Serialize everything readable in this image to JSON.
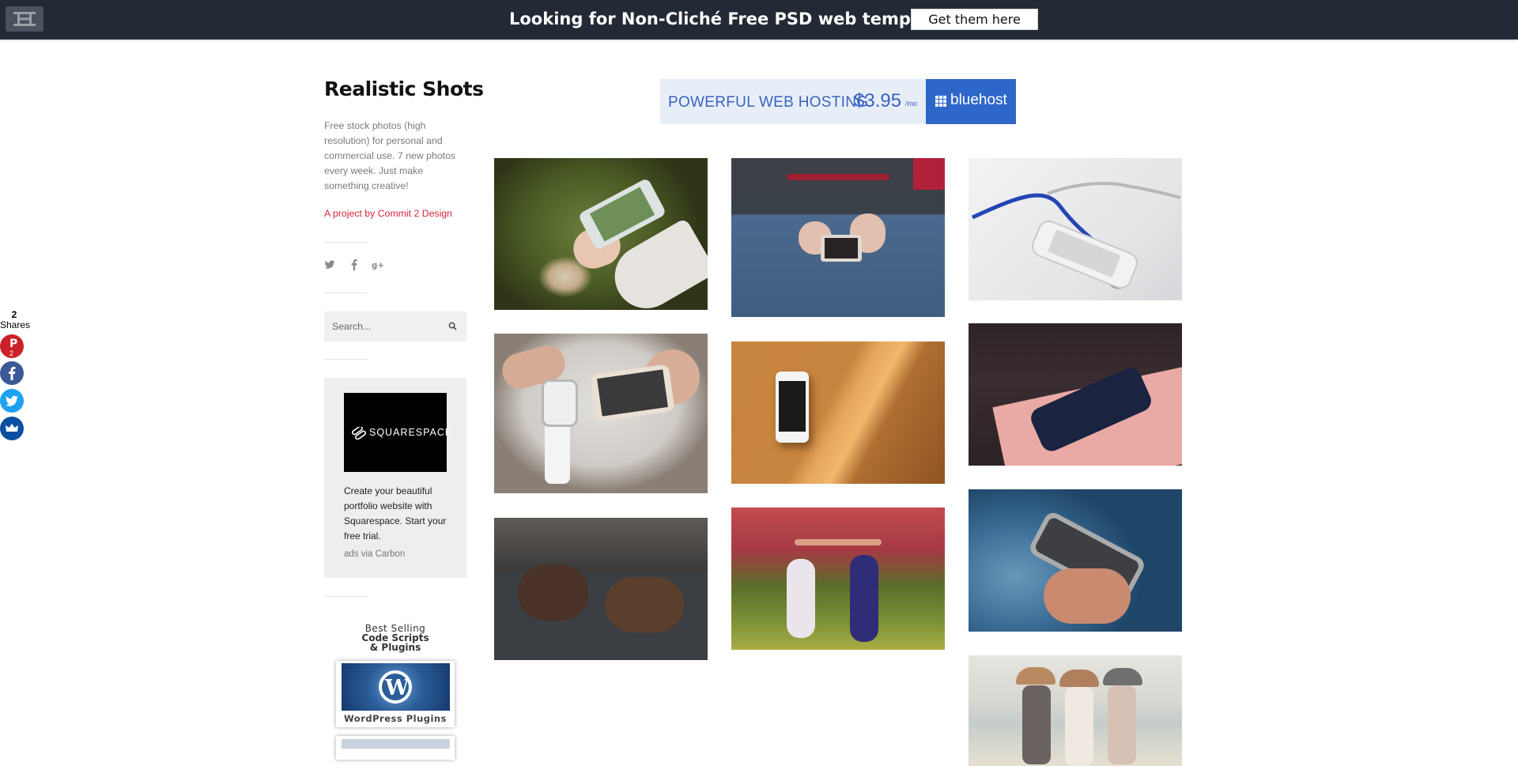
{
  "top_banner": {
    "headline": "Looking for Non-Cliché Free PSD web templates?",
    "cta_label": "Get them here"
  },
  "sidebar": {
    "title": "Realistic Shots",
    "description": "Free stock photos (high resolution) for personal and commercial use. 7 new photos every week. Just make something creative!",
    "project_link": "A project by Commit 2 Design",
    "social_icons": [
      "twitter-icon",
      "facebook-icon",
      "google-plus-icon"
    ],
    "search": {
      "placeholder": "Search..."
    },
    "carbon_ad": {
      "brand": "SQUARESPACE",
      "text": "Create your beautiful portfolio website with Squarespace. Start your free trial.",
      "via": "ads via Carbon"
    },
    "promo": {
      "line1": "Best Selling",
      "line2": "Code Scripts",
      "line3": "& Plugins",
      "card_label": "WordPress Plugins"
    }
  },
  "share_bar": {
    "count": "2",
    "label": "Shares",
    "pinterest_count": "2",
    "buttons": [
      "pinterest-icon",
      "facebook-icon",
      "twitter-icon",
      "sumo-crown-icon"
    ]
  },
  "banner_ad": {
    "tagline": "POWERFUL WEB HOSTING",
    "price": "$3.95",
    "per": "/mo",
    "brand": "bluehost"
  },
  "colors": {
    "topbar_bg": "#232a35",
    "accent_link": "#d8233a",
    "bluehost_blue": "#2f66c9"
  },
  "photos": [
    {
      "subject": "hand holding phone over autumn leaf on grass"
    },
    {
      "subject": "person in jeans texting on phone"
    },
    {
      "subject": "stethoscope beside white smartphone"
    },
    {
      "subject": "hands holding smartwatch and phone"
    },
    {
      "subject": "phone on wooden table in sunlight"
    },
    {
      "subject": "phone on pink notebook"
    },
    {
      "subject": "two girls lying on car hood"
    },
    {
      "subject": "two girls stretching in meadow"
    },
    {
      "subject": "hand holding smartphone"
    },
    {
      "subject": "three girls in hats at the beach"
    }
  ]
}
